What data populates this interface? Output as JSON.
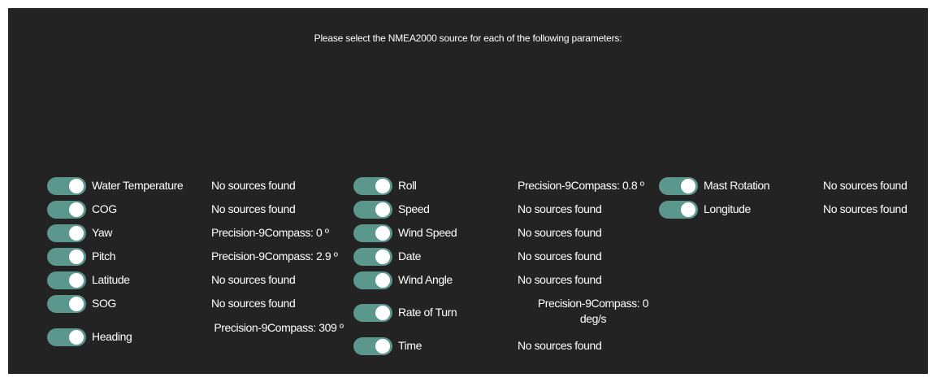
{
  "header": {
    "prompt": "Please select the NMEA2000 source for each of the following parameters:"
  },
  "colors": {
    "background": "#232323",
    "toggle_on": "#5c978d",
    "knob": "#ffffff",
    "text": "#ffffff"
  },
  "parameters": [
    {
      "label": "Water Temperature",
      "source": "No sources found",
      "enabled": true
    },
    {
      "label": "COG",
      "source": "No sources found",
      "enabled": true
    },
    {
      "label": "Yaw",
      "source": "Precision-9Compass: 0 º",
      "enabled": true
    },
    {
      "label": "Pitch",
      "source": "Precision-9Compass: 2.9 º",
      "enabled": true
    },
    {
      "label": "Latitude",
      "source": "No sources found",
      "enabled": true
    },
    {
      "label": "SOG",
      "source": "No sources found",
      "enabled": true
    },
    {
      "label": "Heading",
      "source": "Precision-9Compass: 309 º",
      "enabled": true
    },
    {
      "label": "Roll",
      "source": "Precision-9Compass: 0.8 º",
      "enabled": true
    },
    {
      "label": "Speed",
      "source": "No sources found",
      "enabled": true
    },
    {
      "label": "Wind Speed",
      "source": "No sources found",
      "enabled": true
    },
    {
      "label": "Date",
      "source": "No sources found",
      "enabled": true
    },
    {
      "label": "Wind Angle",
      "source": "No sources found",
      "enabled": true
    },
    {
      "label": "Rate of Turn",
      "source": "Precision-9Compass: 0 deg/s",
      "enabled": true
    },
    {
      "label": "Time",
      "source": "No sources found",
      "enabled": true
    },
    {
      "label": "Mast Rotation",
      "source": "No sources found",
      "enabled": true
    },
    {
      "label": "Longitude",
      "source": "No sources found",
      "enabled": true
    }
  ]
}
